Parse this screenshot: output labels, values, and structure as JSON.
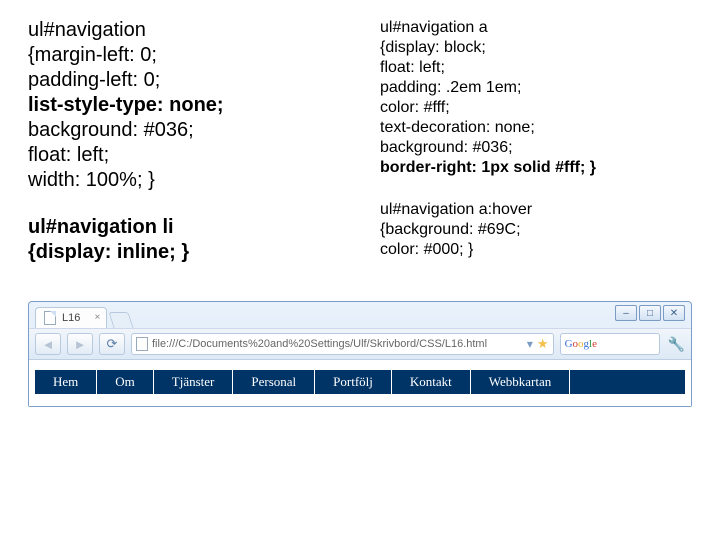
{
  "code": {
    "ul_navigation": {
      "selector": "ul#navigation",
      "lines": [
        "{margin-left: 0;",
        "padding-left: 0;",
        "list-style-type: none;",
        "background: #036;",
        "float: left;",
        "width: 100%; }"
      ],
      "bold_lines": [
        false,
        false,
        true,
        false,
        false,
        false
      ]
    },
    "ul_navigation_li": {
      "selector": "ul#navigation li",
      "body": "{display: inline; }"
    },
    "ul_navigation_a": {
      "selector": "ul#navigation a",
      "lines": [
        "{display: block;",
        "float: left;",
        "padding: .2em 1em;",
        "color: #fff;",
        "text-decoration: none;",
        "background: #036;",
        "border-right: 1px solid #fff; }"
      ],
      "bold_lines": [
        false,
        false,
        false,
        false,
        false,
        false,
        true
      ]
    },
    "ul_navigation_a_hover": {
      "selector": "ul#navigation a:hover",
      "lines": [
        "{background: #69C;",
        "color: #000; }"
      ]
    }
  },
  "browser": {
    "tab_title": "L16",
    "url": "file:///C:/Documents%20and%20Settings/Ulf/Skrivbord/CSS/L16.html",
    "search_placeholder": "Google",
    "win_buttons": {
      "min": "–",
      "max": "□",
      "close": "✕"
    }
  },
  "nav_items": [
    "Hem",
    "Om",
    "Tjänster",
    "Personal",
    "Portfölj",
    "Kontakt",
    "Webbkartan"
  ]
}
